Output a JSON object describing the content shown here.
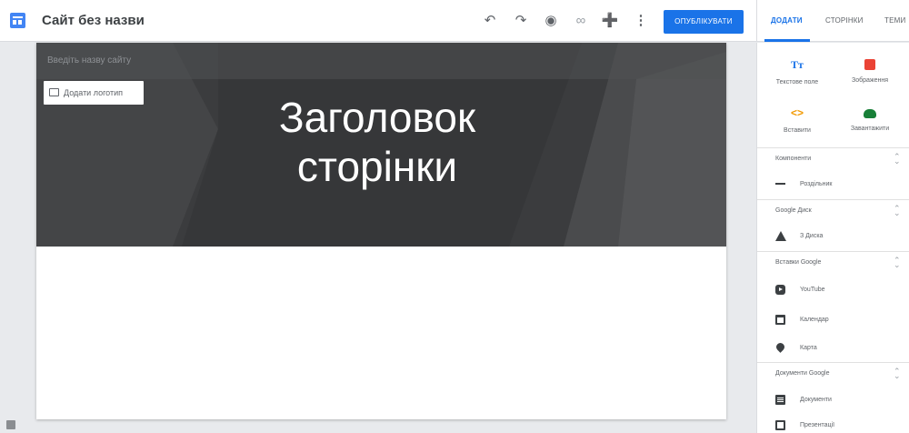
{
  "app": {
    "site_title": "Сайт без назви"
  },
  "toolbar": {
    "undo_icon": "undo-icon",
    "redo_icon": "redo-icon",
    "preview_icon": "eye-icon",
    "link_icon": "link-icon",
    "share_icon": "add-person-icon",
    "more_icon": "more-vert-icon",
    "publish_label": "ОПУБЛІКУВАТИ"
  },
  "side_tabs": [
    {
      "label": "ДОДАТИ",
      "active": true
    },
    {
      "label": "СТОРІНКИ",
      "active": false
    },
    {
      "label": "ТЕМИ",
      "active": false
    }
  ],
  "canvas": {
    "site_name_placeholder": "Введіть назву сайту",
    "add_logo_label": "Додати логотип",
    "page_title_line1": "Заголовок",
    "page_title_line2": "сторінки"
  },
  "insert_grid": [
    {
      "label": "Текстове поле",
      "icon": "text-box-icon"
    },
    {
      "label": "Зображення",
      "icon": "image-icon"
    },
    {
      "label": "Вставити",
      "icon": "embed-code-icon"
    },
    {
      "label": "Завантажити",
      "icon": "upload-cloud-icon"
    }
  ],
  "sections": {
    "components": {
      "title": "Компоненти",
      "items": [
        {
          "label": "Роздільник"
        }
      ]
    },
    "drive": {
      "title": "Google Диск",
      "items": [
        {
          "label": "З Диска"
        }
      ]
    },
    "embed_google": {
      "title": "Вставки Google",
      "items": [
        {
          "label": "YouTube"
        },
        {
          "label": "Календар"
        },
        {
          "label": "Карта"
        }
      ]
    },
    "docs_google": {
      "title": "Документи Google",
      "items": [
        {
          "label": "Документи"
        },
        {
          "label": "Презентації"
        }
      ]
    }
  },
  "colors": {
    "accent": "#1a73e8",
    "header_bg": "#3b3c3e",
    "image_icon": "#ea4335",
    "embed_icon": "#f29900",
    "upload_icon": "#188038"
  }
}
